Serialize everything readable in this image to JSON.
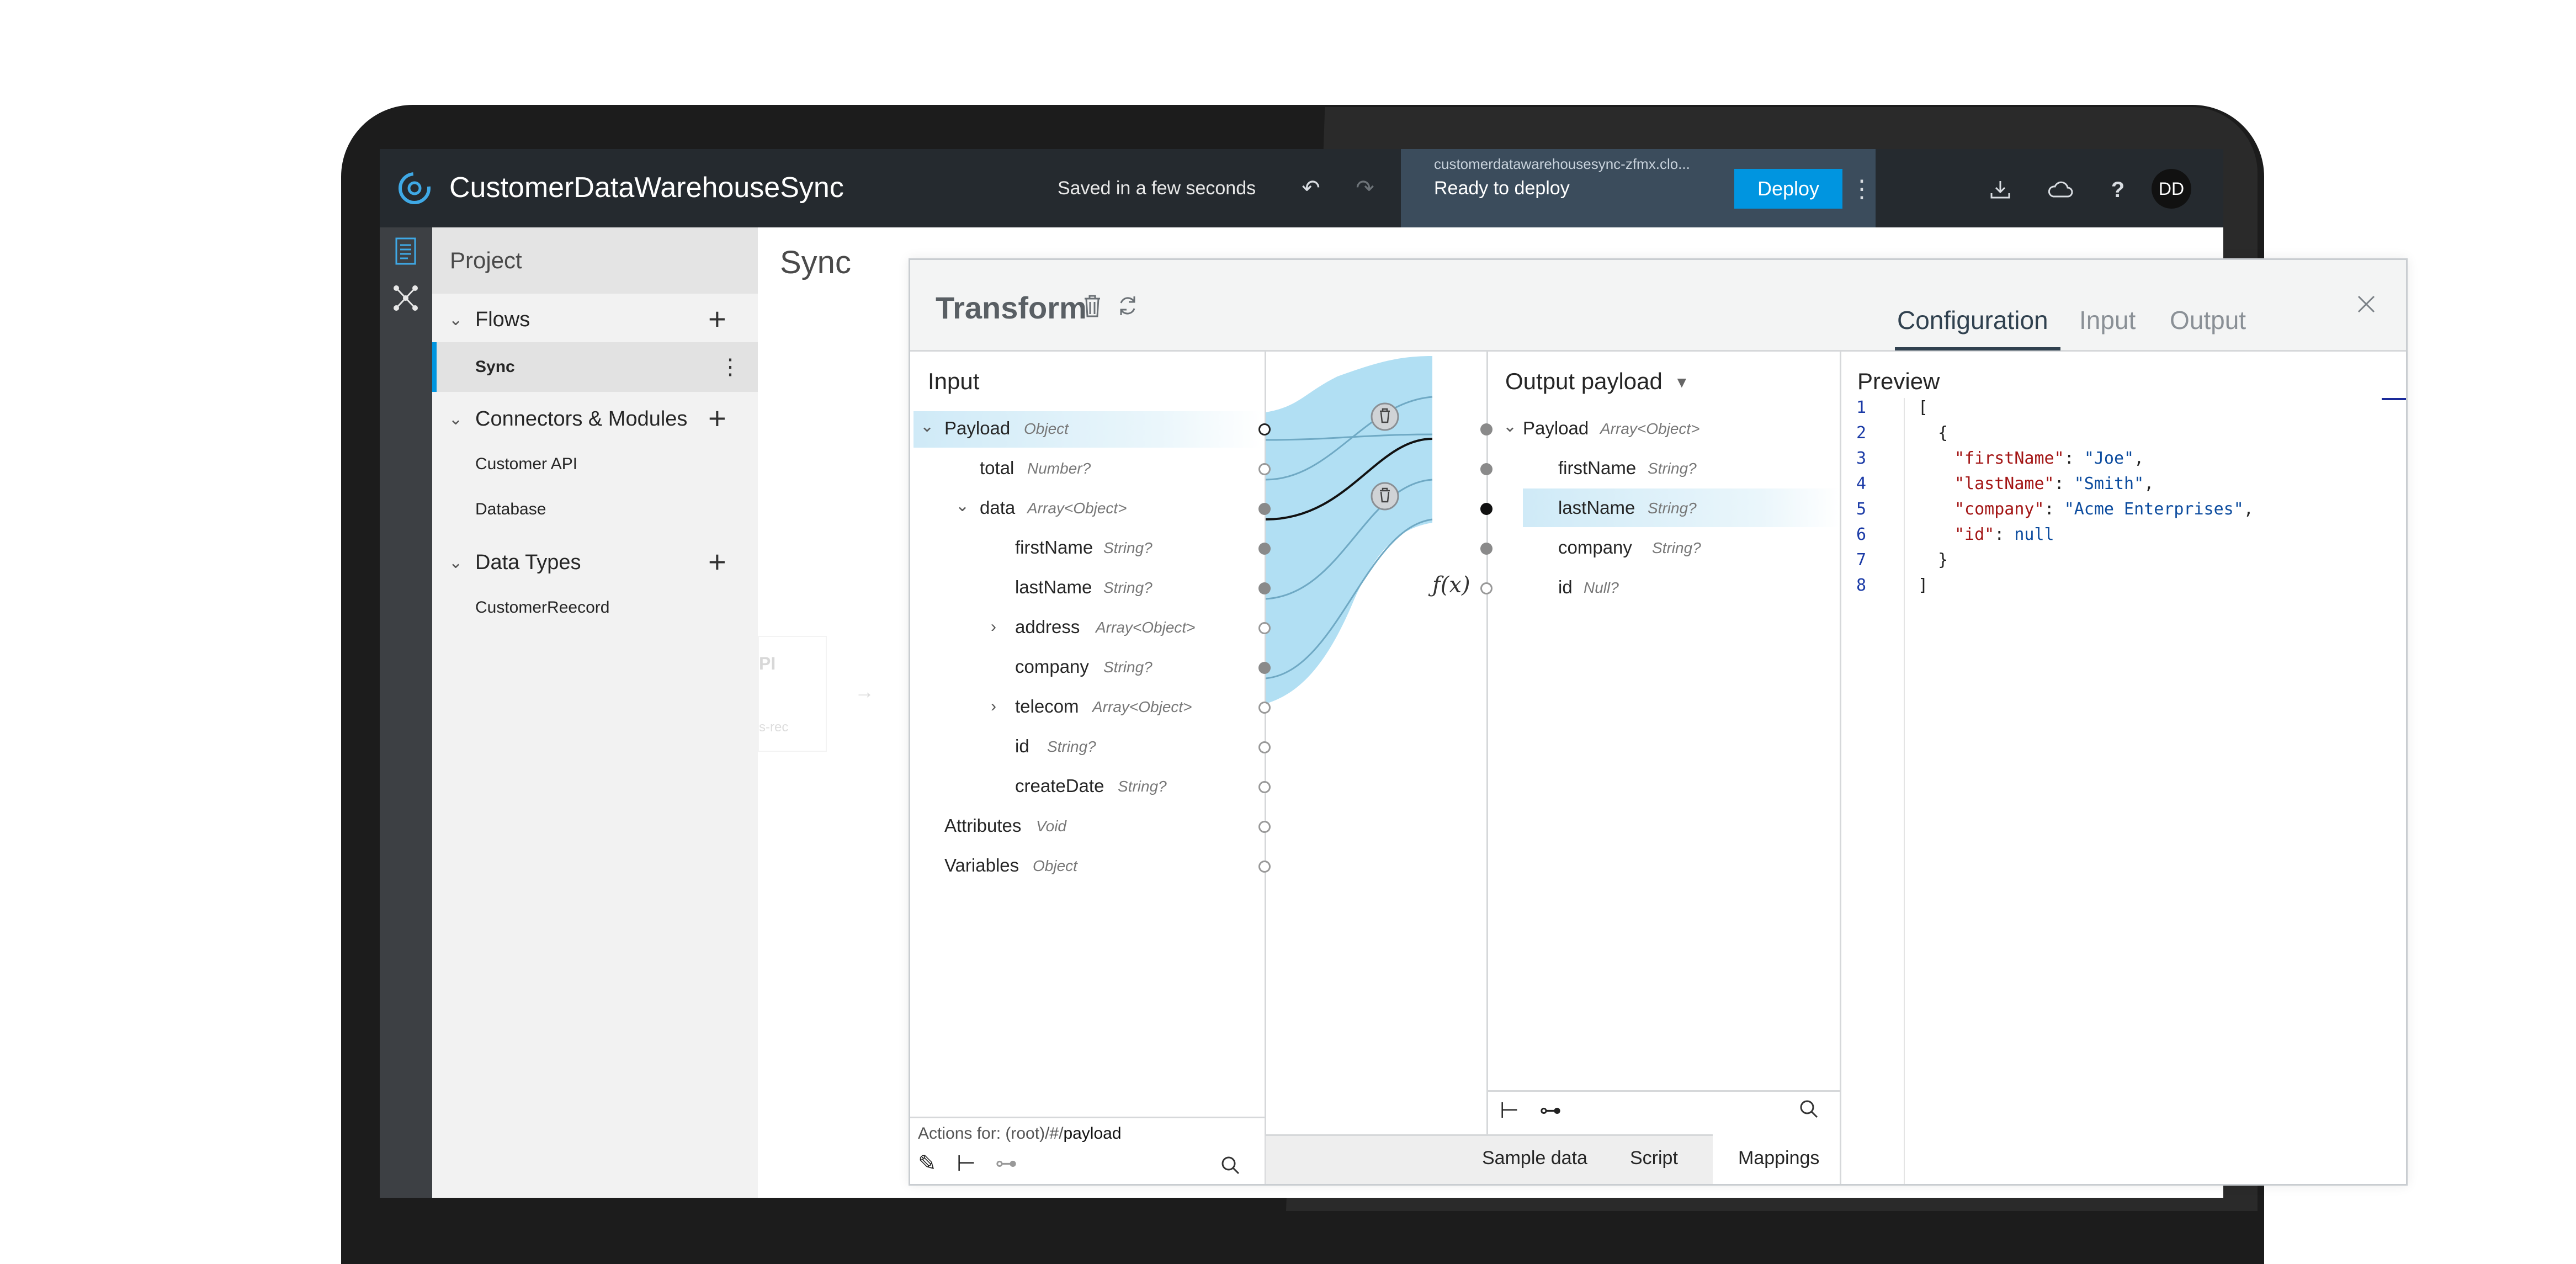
{
  "header": {
    "app_title": "CustomerDataWarehouseSync",
    "save_status": "Saved in a few seconds",
    "deploy_url": "customerdatawarehousesync-zfmx.clo...",
    "deploy_status": "Ready to deploy",
    "deploy_label": "Deploy",
    "avatar_initials": "DD",
    "help_label": "?"
  },
  "sidebar": {
    "title": "Project",
    "flows_label": "Flows",
    "sync_label": "Sync",
    "connectors_label": "Connectors & Modules",
    "connector_items": [
      "Customer API",
      "Database"
    ],
    "datatypes_label": "Data Types",
    "datatype_items": [
      "CustomerReecord"
    ]
  },
  "canvas": {
    "title": "Sync",
    "ghost_label": "PI",
    "ghost_sub": "s-rec"
  },
  "transform": {
    "title": "Transform",
    "tabs": [
      "Configuration",
      "Input",
      "Output"
    ],
    "active_tab": "Configuration",
    "input_title": "Input",
    "input_tree": [
      {
        "name": "Payload",
        "type": "Object"
      },
      {
        "name": "total",
        "type": "Number?"
      },
      {
        "name": "data",
        "type": "Array<Object>"
      },
      {
        "name": "firstName",
        "type": "String?"
      },
      {
        "name": "lastName",
        "type": "String?"
      },
      {
        "name": "address",
        "type": "Array<Object>"
      },
      {
        "name": "company",
        "type": "String?"
      },
      {
        "name": "telecom",
        "type": "Array<Object>"
      },
      {
        "name": "id",
        "type": "String?"
      },
      {
        "name": "createDate",
        "type": "String?"
      },
      {
        "name": "Attributes",
        "type": "Void"
      },
      {
        "name": "Variables",
        "type": "Object"
      }
    ],
    "output_title": "Output payload",
    "output_tree": [
      {
        "name": "Payload",
        "type": "Array<Object>"
      },
      {
        "name": "firstName",
        "type": "String?"
      },
      {
        "name": "lastName",
        "type": "String?"
      },
      {
        "name": "company",
        "type": "String?"
      },
      {
        "name": "id",
        "type": "Null?"
      }
    ],
    "function_label": "ƒ(x)",
    "actions_prefix": "Actions for: (root)/#/",
    "actions_target": "payload",
    "bottom_tabs": [
      "Sample data",
      "Script",
      "Mappings"
    ],
    "active_bottom_tab": "Mappings",
    "preview_title": "Preview",
    "preview_lines": [
      "1",
      "2",
      "3",
      "4",
      "5",
      "6",
      "7",
      "8"
    ],
    "preview_code": {
      "l1": "[",
      "l2": "  {",
      "k3": "\"firstName\"",
      "v3": "\"Joe\"",
      "k4": "\"lastName\"",
      "v4": "\"Smith\"",
      "k5": "\"company\"",
      "v5": "\"Acme Enterprises\"",
      "k6": "\"id\"",
      "v6": "null",
      "l7": "  }",
      "l8": "]"
    }
  },
  "colors": {
    "accent": "#0095e0",
    "header_bg": "#252a2f",
    "mapping_fill": "#a8dcf2"
  }
}
